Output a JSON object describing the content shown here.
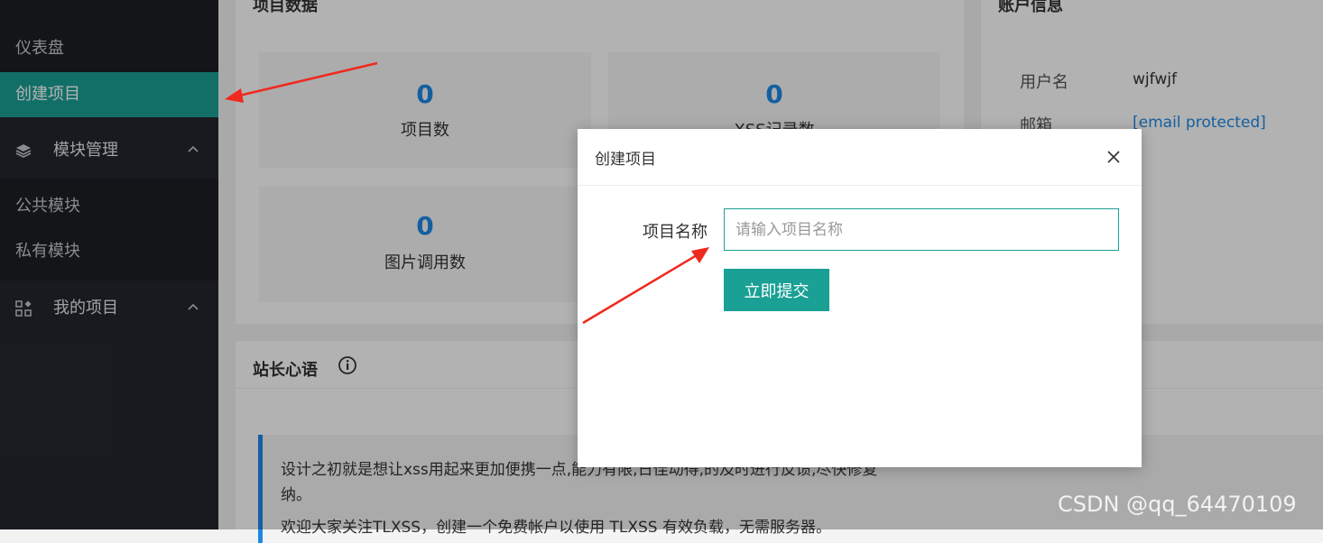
{
  "sidebar": {
    "items": [
      {
        "label": "仪表盘"
      },
      {
        "label": "创建项目",
        "active": true
      }
    ],
    "groups": [
      {
        "label": "模块管理",
        "icon": "layers-icon",
        "children": [
          {
            "label": "公共模块"
          },
          {
            "label": "私有模块"
          }
        ]
      },
      {
        "label": "我的项目",
        "icon": "apps-icon"
      }
    ]
  },
  "project_data": {
    "title": "项目数据",
    "stats": [
      {
        "value": "0",
        "label": "项目数"
      },
      {
        "value": "0",
        "label": "XSS记录数"
      },
      {
        "value": "0",
        "label": "图片调用数"
      }
    ]
  },
  "account": {
    "title": "账户信息",
    "username_label": "用户名",
    "username_value": "wjfwjf",
    "email_label": "邮箱",
    "email_value": "[email protected]"
  },
  "notes": {
    "title": "站长心语",
    "paragraph1": "设计之初就是想让xss用起来更加便携一点,能力有限,日佳动得,的及时进行反馈,尽快修复",
    "paragraph1_cont": "纳。",
    "paragraph2": "欢迎大家关注TLXSS，创建一个免费帐户以使用 TLXSS 有效负载，无需服务器。"
  },
  "modal": {
    "title": "创建项目",
    "field_label": "项目名称",
    "placeholder": "请输入项目名称",
    "value": "",
    "submit_label": "立即提交"
  },
  "watermark": "CSDN @qq_64470109",
  "colors": {
    "accent": "#1aa094",
    "link": "#1e88e5",
    "sidebar": "#23262e",
    "arrow": "#f0291e"
  }
}
